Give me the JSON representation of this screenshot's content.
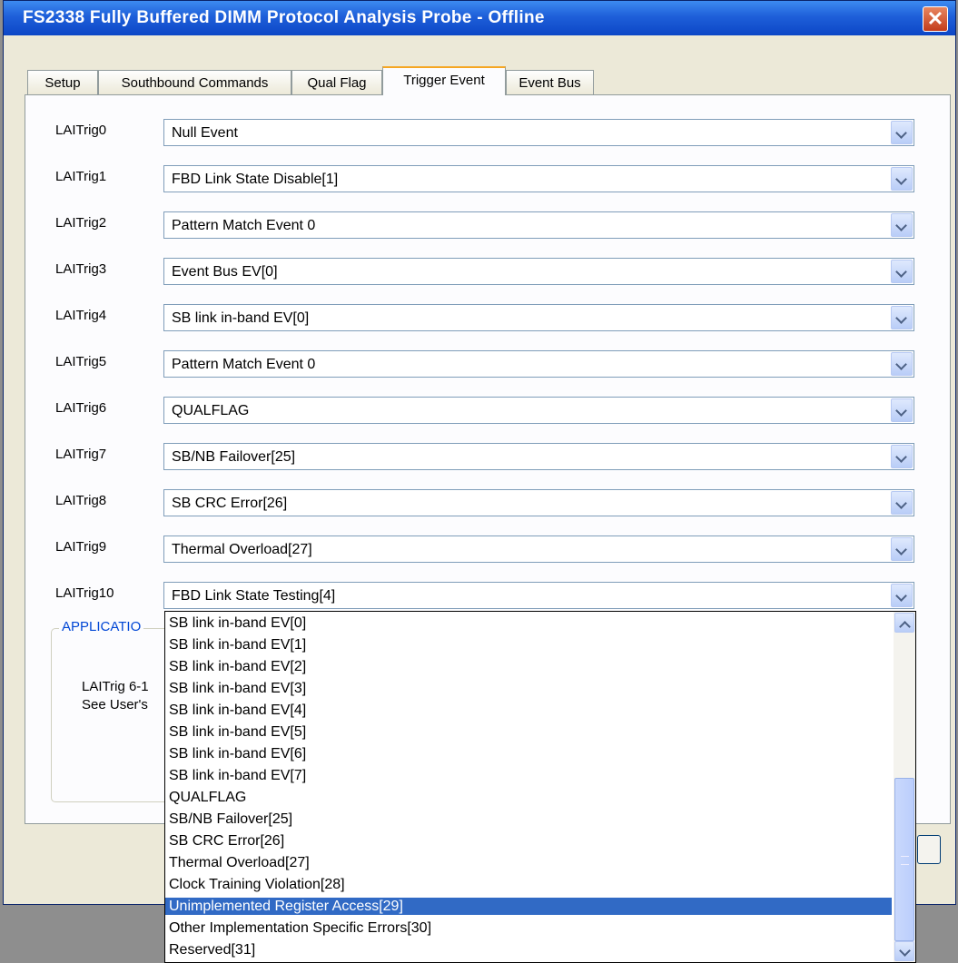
{
  "window": {
    "title": "FS2338 Fully Buffered DIMM Protocol Analysis Probe - Offline",
    "close_icon": "close-icon"
  },
  "tabs": [
    "Setup",
    "Southbound Commands",
    "Qual Flag",
    "Trigger Event",
    "Event Bus"
  ],
  "active_tab": "Trigger Event",
  "triggers": [
    {
      "label": "LAITrig0",
      "value": "Null Event"
    },
    {
      "label": "LAITrig1",
      "value": "FBD Link State Disable[1]"
    },
    {
      "label": "LAITrig2",
      "value": "Pattern Match Event 0"
    },
    {
      "label": "LAITrig3",
      "value": "Event Bus EV[0]"
    },
    {
      "label": "LAITrig4",
      "value": "SB link in-band EV[0]"
    },
    {
      "label": "LAITrig5",
      "value": "Pattern Match Event 0"
    },
    {
      "label": "LAITrig6",
      "value": "QUALFLAG"
    },
    {
      "label": "LAITrig7",
      "value": "SB/NB Failover[25]"
    },
    {
      "label": "LAITrig8",
      "value": "SB CRC Error[26]"
    },
    {
      "label": "LAITrig9",
      "value": "Thermal Overload[27]"
    },
    {
      "label": "LAITrig10",
      "value": "FBD Link State Testing[4]"
    }
  ],
  "application_group": {
    "legend": "APPLICATIO",
    "line1": "LAITrig 6-1",
    "line2": "See User's"
  },
  "dropdown": {
    "options": [
      "SB link in-band EV[0]",
      "SB link in-band EV[1]",
      "SB link in-band EV[2]",
      "SB link in-band EV[3]",
      "SB link in-band EV[4]",
      "SB link in-band EV[5]",
      "SB link in-band EV[6]",
      "SB link in-band EV[7]",
      "QUALFLAG",
      "SB/NB Failover[25]",
      "SB CRC Error[26]",
      "Thermal Overload[27]",
      "Clock Training Violation[28]",
      "Unimplemented Register Access[29]",
      "Other Implementation Specific Errors[30]",
      "Reserved[31]"
    ],
    "selected_index": 13
  },
  "colors": {
    "title_bar": "#1e5fd9",
    "selection": "#316ac5",
    "group_legend": "#0046d5",
    "tab_highlight": "#f5a623"
  }
}
